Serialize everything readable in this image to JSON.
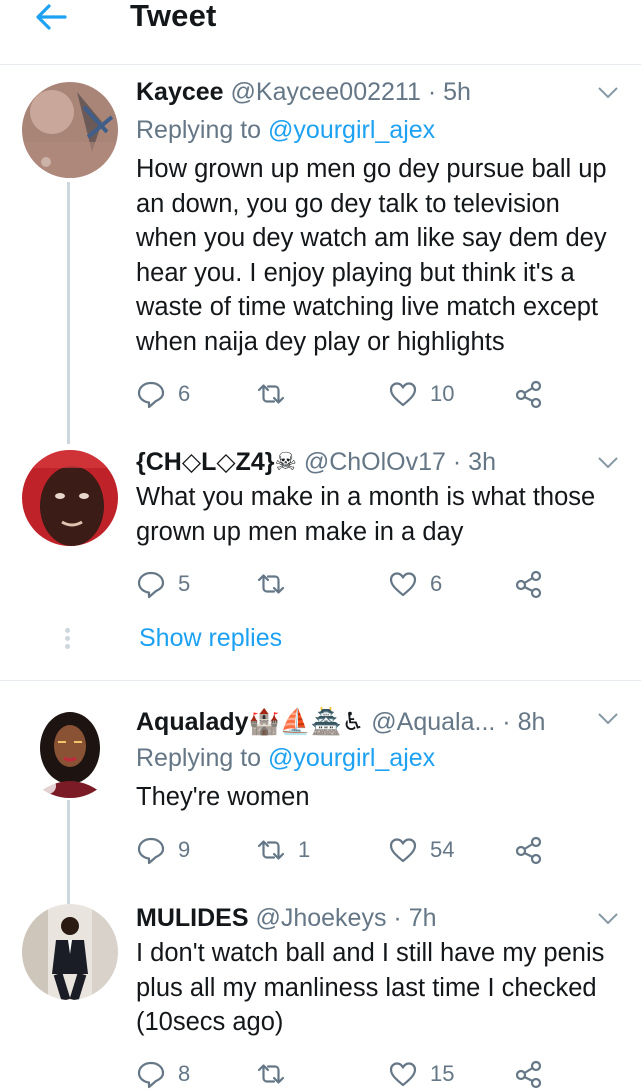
{
  "header": {
    "title": "Tweet"
  },
  "tweets": [
    {
      "name": "Kaycee",
      "handle": "@Kaycee002211",
      "time": "5h",
      "replying_label": "Replying to",
      "replying_to": "@yourgirl_ajex",
      "text": "How grown up men go dey pursue ball up an down, you go dey talk to television when you dey watch am like say dem dey hear you. I enjoy playing but think it's a waste of time watching live match except when naija dey play or highlights",
      "replies": "6",
      "retweets": "",
      "likes": "10"
    },
    {
      "name": "{CH◇L◇Z4}☠",
      "handle": "@ChOlOv17",
      "time": "3h",
      "text": "What you make in a month is what those grown up men make in a day",
      "replies": "5",
      "retweets": "",
      "likes": "6"
    },
    {
      "name": "Aqualady🏰⛵🏯♿",
      "handle": "@Aquala...",
      "time": "8h",
      "replying_label": "Replying to",
      "replying_to": "@yourgirl_ajex",
      "text": "They're women",
      "replies": "9",
      "retweets": "1",
      "likes": "54"
    },
    {
      "name": "MULIDES",
      "handle": "@Jhoekeys",
      "time": "7h",
      "text": "I don't watch ball and I still have my penis plus all my manliness last time I checked (10secs ago)",
      "replies": "8",
      "retweets": "",
      "likes": "15"
    }
  ],
  "show_replies": "Show replies",
  "colors": {
    "accent": "#1da1f2",
    "secondary_text": "#657786",
    "divider": "#e6ecf0"
  },
  "icons": [
    "back-arrow-icon",
    "chevron-down-icon",
    "reply-icon",
    "retweet-icon",
    "like-icon",
    "share-icon"
  ]
}
